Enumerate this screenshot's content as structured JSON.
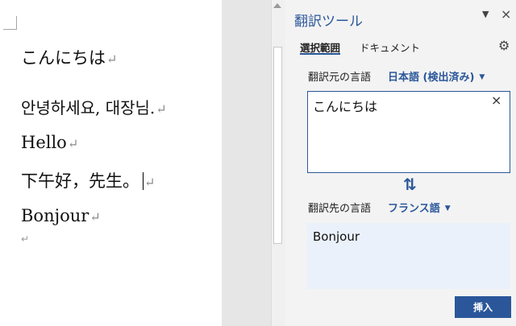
{
  "document": {
    "paragraphs": [
      "こんにちは",
      "안녕하세요, 대장님.",
      "Hello",
      "下午好，先生。",
      "Bonjour"
    ],
    "paragraph_mark": "↵"
  },
  "pane": {
    "title": "翻訳ツール",
    "menu_icon": "▼",
    "close_icon": "×",
    "tabs": [
      {
        "label": "選択範囲",
        "selected": true
      },
      {
        "label": "ドキュメント",
        "selected": false
      }
    ],
    "settings_icon": "⚙",
    "source": {
      "label": "翻訳元の言語",
      "language": "日本語 (検出済み)",
      "text": "こんにちは",
      "clear_icon": "×"
    },
    "swap_icon": "⇅",
    "target": {
      "label": "翻訳先の言語",
      "language": "フランス語",
      "text": "Bonjour"
    },
    "dropdown_icon": "▼",
    "insert_label": "挿入"
  },
  "colors": {
    "accent": "#2b579a",
    "pane_bg": "#f3f3f3",
    "target_bg": "#eaf1fb"
  }
}
